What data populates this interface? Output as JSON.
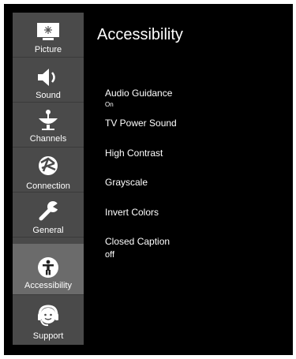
{
  "page": {
    "title": "Accessibility"
  },
  "sidebar": {
    "items": [
      {
        "label": "Picture",
        "icon": "picture-icon"
      },
      {
        "label": "Sound",
        "icon": "speaker-icon"
      },
      {
        "label": "Channels",
        "icon": "satellite-dish-icon"
      },
      {
        "label": "Connection",
        "icon": "globe-network-icon"
      },
      {
        "label": "General",
        "icon": "wrench-icon"
      },
      {
        "label": "Accessibility",
        "icon": "accessibility-icon",
        "selected": true
      },
      {
        "label": "Support",
        "icon": "headset-icon"
      }
    ]
  },
  "settings": [
    {
      "label": "Audio Guidance",
      "value": "On"
    },
    {
      "label": "TV Power Sound"
    },
    {
      "label": "High Contrast"
    },
    {
      "label": "Grayscale"
    },
    {
      "label": "Invert Colors"
    },
    {
      "label": "Closed Caption",
      "value": "off"
    }
  ],
  "colors": {
    "background": "#000000",
    "sidebar": "#4a4a4a",
    "selected": "#6b6b6b",
    "text": "#ffffff"
  }
}
